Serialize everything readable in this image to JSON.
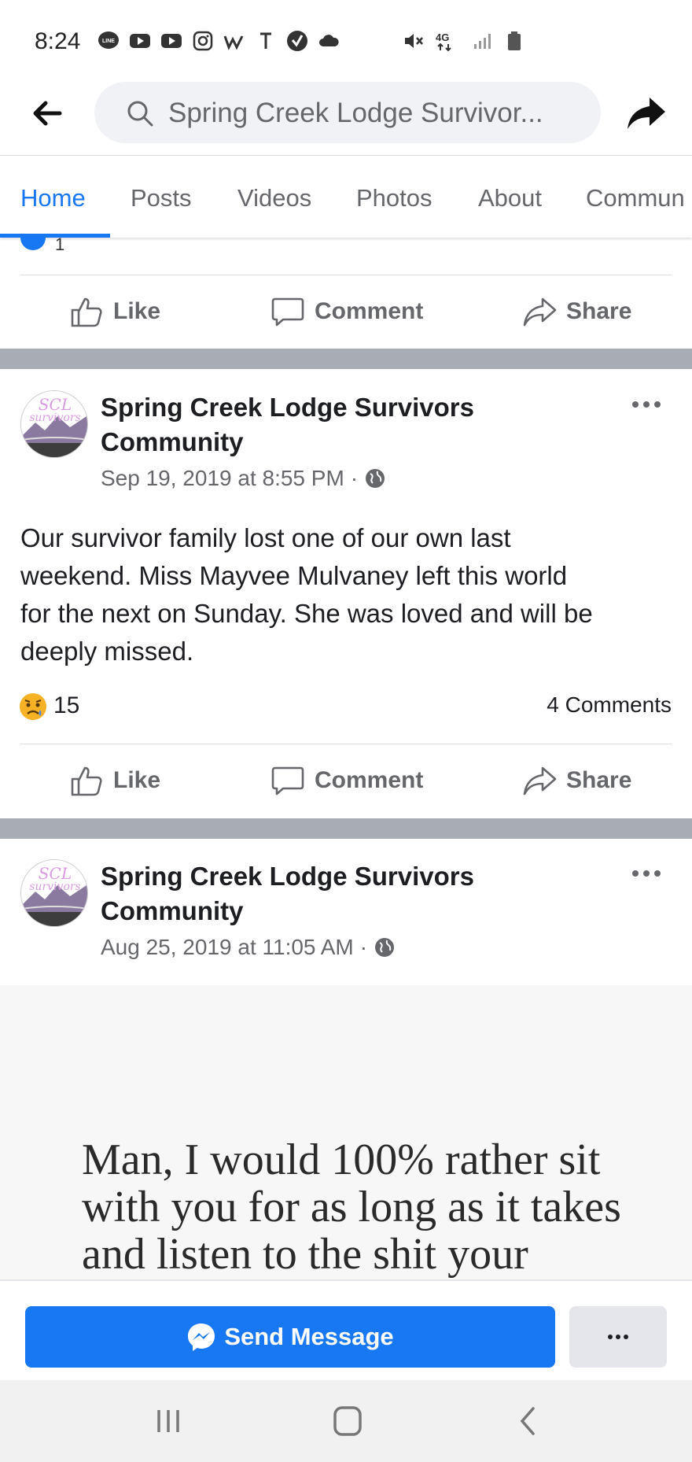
{
  "status_bar": {
    "time": "8:24",
    "line_label": "LINE",
    "network_label": "4G",
    "left_icons": [
      "line-icon",
      "youtube-icon",
      "youtube-icon",
      "instagram-icon",
      "w-icon",
      "t-icon",
      "check-icon",
      "cloud-icon"
    ],
    "right_icons": [
      "mute-icon",
      "network-icon",
      "signal-icon",
      "battery-icon"
    ]
  },
  "header": {
    "search_text": "Spring Creek Lodge Survivor..."
  },
  "tabs": [
    {
      "label": "Home",
      "active": true
    },
    {
      "label": "Posts"
    },
    {
      "label": "Videos"
    },
    {
      "label": "Photos"
    },
    {
      "label": "About"
    },
    {
      "label": "Commun"
    }
  ],
  "partial_post": {
    "reaction_count": "1",
    "actions": {
      "like": "Like",
      "comment": "Comment",
      "share": "Share"
    }
  },
  "posts": [
    {
      "avatar_text": {
        "top": "SCL",
        "bottom": "survivors"
      },
      "author_line1": "Spring Creek Lodge Survivors",
      "author_line2": "Community",
      "timestamp": "Sep 19, 2019 at 8:55 PM",
      "separator": "·",
      "text_lines": [
        "Our survivor family lost one of our own last",
        "weekend. Miss Mayvee Mulvaney left this world",
        "for the next on Sunday. She was loved and will be",
        "deeply missed."
      ],
      "reaction_emoji": "sad-emoji",
      "reaction_count": "15",
      "comments": "4 Comments",
      "actions": {
        "like": "Like",
        "comment": "Comment",
        "share": "Share"
      }
    },
    {
      "avatar_text": {
        "top": "SCL",
        "bottom": "survivors"
      },
      "author_line1": "Spring Creek Lodge Survivors",
      "author_line2": "Community",
      "timestamp": "Aug 25, 2019 at 11:05 AM",
      "separator": "·",
      "image_quote_lines": [
        "Man, I would 100% rather sit",
        "with you for as long as it takes",
        "and listen to the shit your"
      ]
    }
  ],
  "message_bar": {
    "send_label": "Send Message",
    "more_label": "···"
  },
  "colors": {
    "accent": "#1877f2",
    "gap": "#a7adb3",
    "muted_text": "#65676b"
  }
}
